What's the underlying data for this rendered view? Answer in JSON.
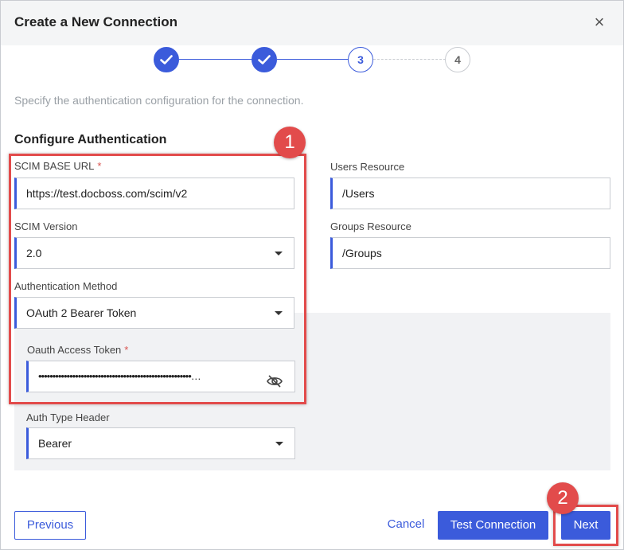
{
  "dialog": {
    "title": "Create a New Connection",
    "close_glyph": "×"
  },
  "stepper": {
    "steps": [
      {
        "status": "done",
        "label": ""
      },
      {
        "status": "done",
        "label": ""
      },
      {
        "status": "current",
        "label": "3"
      },
      {
        "status": "todo",
        "label": "4"
      }
    ]
  },
  "description": "Specify the authentication configuration for the connection.",
  "section_title": "Configure Authentication",
  "fields": {
    "scim_base_url": {
      "label": "SCIM BASE URL",
      "required_mark": "*",
      "value": "https://test.docboss.com/scim/v2"
    },
    "scim_version": {
      "label": "SCIM Version",
      "value": "2.0"
    },
    "auth_method": {
      "label": "Authentication Method",
      "value": "OAuth 2 Bearer Token"
    },
    "oauth_token": {
      "label": "Oauth Access Token",
      "required_mark": "*",
      "value": "••••••••••••••••••••••••••••••••••••••••••••••••••••••…"
    },
    "auth_type_header": {
      "label": "Auth Type Header",
      "value": "Bearer"
    },
    "users_resource": {
      "label": "Users Resource",
      "value": "/Users"
    },
    "groups_resource": {
      "label": "Groups Resource",
      "value": "/Groups"
    }
  },
  "annotations": {
    "badge1": "1",
    "badge2": "2"
  },
  "footer": {
    "previous_label": "Previous",
    "cancel_label": "Cancel",
    "test_connection_label": "Test Connection",
    "next_label": "Next"
  },
  "colors": {
    "accent": "#3b5bdb",
    "annotation": "#e24b4b",
    "required": "#d9534f"
  },
  "icons": {
    "done_step": "check-icon",
    "close": "close-icon",
    "dropdown": "chevron-down-icon",
    "password_toggle": "eye-off-icon"
  }
}
